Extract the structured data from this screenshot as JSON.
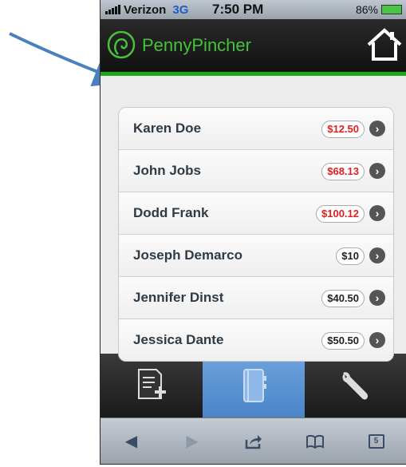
{
  "status": {
    "carrier": "Verizon",
    "network": "3G",
    "time": "7:50 PM",
    "battery": "86%"
  },
  "app": {
    "name": "PennyPincher"
  },
  "contacts": [
    {
      "name": "Karen Doe",
      "amount": "$12.50",
      "negative": true
    },
    {
      "name": "John Jobs",
      "amount": "$68.13",
      "negative": true
    },
    {
      "name": "Dodd Frank",
      "amount": "$100.12",
      "negative": true
    },
    {
      "name": "Joseph Demarco",
      "amount": "$10",
      "negative": false
    },
    {
      "name": "Jennifer Dinst",
      "amount": "$40.50",
      "negative": false
    },
    {
      "name": "Jessica Dante",
      "amount": "$50.50",
      "negative": false
    }
  ],
  "tabbar": {
    "tabs": [
      {
        "icon": "new-document-icon"
      },
      {
        "icon": "address-book-icon",
        "active": true
      },
      {
        "icon": "wrench-icon"
      }
    ]
  },
  "browser": {
    "tabs_count": "5"
  },
  "colors": {
    "accent": "#1ea61e",
    "negative_amount": "#e02020",
    "active_tab": "#4a85c8"
  }
}
